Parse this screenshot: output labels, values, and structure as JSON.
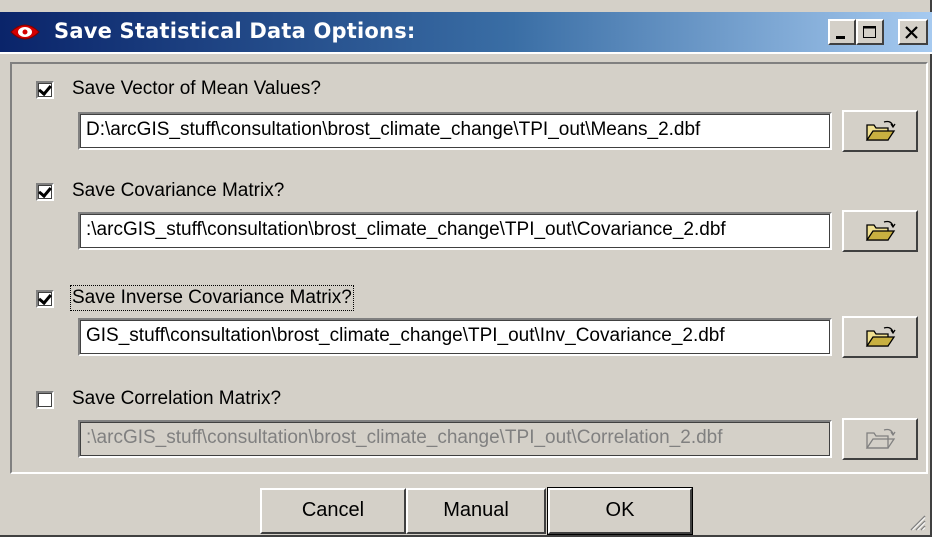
{
  "window": {
    "title": "Save Statistical Data Options:",
    "icon": "red-eye-icon",
    "controls": [
      "minimize-icon",
      "maximize-icon",
      "close-icon"
    ]
  },
  "options": [
    {
      "label": "Save Vector of Mean Values?",
      "checked": true,
      "enabled": true,
      "path": "D:\\arcGIS_stuff\\consultation\\brost_climate_change\\TPI_out\\Means_2.dbf"
    },
    {
      "label": "Save Covariance Matrix?",
      "checked": true,
      "enabled": true,
      "path": ":\\arcGIS_stuff\\consultation\\brost_climate_change\\TPI_out\\Covariance_2.dbf"
    },
    {
      "label": "Save Inverse Covariance Matrix?",
      "checked": true,
      "enabled": true,
      "focused": true,
      "path": "GIS_stuff\\consultation\\brost_climate_change\\TPI_out\\Inv_Covariance_2.dbf"
    },
    {
      "label": "Save Correlation Matrix?",
      "checked": false,
      "enabled": false,
      "path": ":\\arcGIS_stuff\\consultation\\brost_climate_change\\TPI_out\\Correlation_2.dbf"
    }
  ],
  "buttons": {
    "cancel": "Cancel",
    "manual": "Manual",
    "ok": "OK"
  },
  "colors": {
    "face": "#d4d0c8",
    "title_start": "#0a246a",
    "title_end": "#a6caf0",
    "disabled_text": "#808080"
  }
}
